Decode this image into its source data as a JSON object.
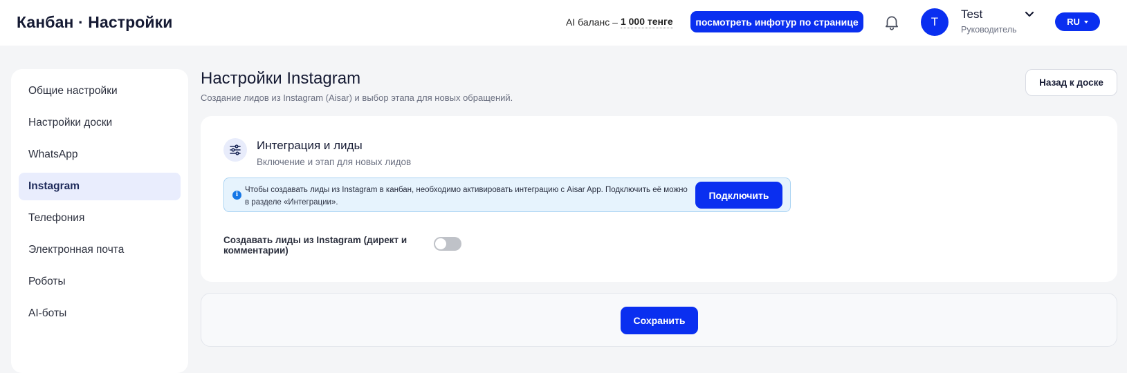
{
  "header": {
    "title": "Канбан · Настройки",
    "ai_balance_label": "AI баланс –",
    "ai_balance_value": "1 000 тенге",
    "tour_button": "посмотреть инфотур по странице",
    "user": {
      "initial": "T",
      "name": "Test",
      "role": "Руководитель"
    },
    "language": "RU"
  },
  "sidebar": {
    "items": [
      {
        "label": "Общие настройки",
        "active": false
      },
      {
        "label": "Настройки доски",
        "active": false
      },
      {
        "label": "WhatsApp",
        "active": false
      },
      {
        "label": "Instagram",
        "active": true
      },
      {
        "label": "Телефония",
        "active": false
      },
      {
        "label": "Электронная почта",
        "active": false
      },
      {
        "label": "Роботы",
        "active": false
      },
      {
        "label": "AI-боты",
        "active": false
      }
    ]
  },
  "main": {
    "title": "Настройки Instagram",
    "subtitle": "Создание лидов из Instagram (Aisar) и выбор этапа для новых обращений.",
    "back_button": "Назад к доске",
    "card": {
      "title": "Интеграция и лиды",
      "subtitle": "Включение и этап для новых лидов",
      "info_icon": "i",
      "info_text": "Чтобы создавать лиды из Instagram в канбан, необходимо активировать интеграцию с Aisar App. Подключить её можно в разделе «Интеграции».",
      "connect_button": "Подключить",
      "toggle_label": "Создавать лиды из Instagram (директ и комментарии)",
      "toggle_on": false
    },
    "save_button": "Сохранить"
  },
  "colors": {
    "primary": "#0a2ff0",
    "background": "#f4f5f7",
    "active_nav": "#e9edfd",
    "info_bg": "#e6f3fd",
    "info_border": "#a9d3f3"
  },
  "icons": {
    "bell": "bell-icon",
    "chevron": "chevron-down-icon",
    "card": "sliders-icon",
    "info": "info-icon"
  }
}
